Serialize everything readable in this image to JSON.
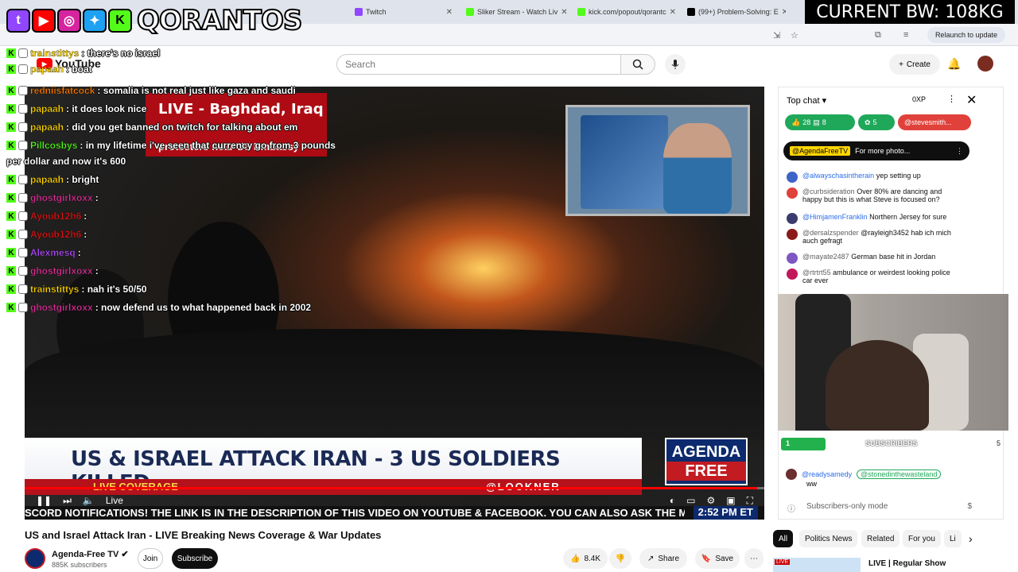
{
  "browser": {
    "tabs": [
      {
        "label": "Twitch",
        "color": "#9146ff"
      },
      {
        "label": "Sliker Stream - Watch Liv",
        "color": "#53fc18"
      },
      {
        "label": "kick.com/popout/qorantc",
        "color": "#53fc18"
      },
      {
        "label": "(99+) Problem-Solving: E",
        "color": "#000000"
      }
    ],
    "relaunch": "Relaunch to update"
  },
  "overlay": {
    "streamer": "QORANTOS",
    "bw_label": "CURRENT BW: 108KG",
    "stream_chat": [
      {
        "user": "trainstittys",
        "msg": ": there's no israel",
        "color": "#ffd600"
      },
      {
        "user": "papaah",
        "msg": ": boat",
        "color": "#ffd600"
      },
      {
        "user": "redniisfatcock",
        "msg": ": somalia is not real just like gaza and saudi",
        "color": "#ff7a00"
      },
      {
        "user": "papaah",
        "msg": ": it does look nice",
        "color": "#ffd600"
      },
      {
        "user": "papaah",
        "msg": ": did you get banned on twitch for talking about em",
        "color": "#ffd600"
      },
      {
        "user": "Pillcosbys",
        "msg": ": in my lifetime i've seen that currency go from 3 pounds",
        "color": "#53fc18"
      },
      {
        "user": "",
        "msg": "per dollar and now it's 600",
        "color": "#ffffff"
      },
      {
        "user": "papaah",
        "msg": ": bright",
        "color": "#ffd600"
      },
      {
        "user": "ghostgirlxoxx",
        "msg": ":",
        "color": "#e0309a"
      },
      {
        "user": "Ayoub12h6",
        "msg": ":",
        "color": "#e01515"
      },
      {
        "user": "Ayoub12h6",
        "msg": ":",
        "color": "#e01515"
      },
      {
        "user": "Alexmesq",
        "msg": ":",
        "color": "#b44cff"
      },
      {
        "user": "ghostgirlxoxx",
        "msg": ":",
        "color": "#e0309a"
      },
      {
        "user": "trainstittys",
        "msg": ": nah it's 50/50",
        "color": "#ffd600"
      },
      {
        "user": "ghostgirlxoxx",
        "msg": ": now defend us to what happened back in 2002",
        "color": "#e0309a"
      }
    ]
  },
  "youtube": {
    "logo": "YouTube",
    "search_placeholder": "Search",
    "create": "Create",
    "video": {
      "live_title": "LIVE - Baghdad, Iraq",
      "live_sub": "protesters near US Embassy",
      "lower_third": "US & ISRAEL ATTACK IRAN - 3 US SOLDIERS KILLED",
      "live_coverage": "LIVE COVERAGE",
      "handle": "@LOOKNER",
      "brand_top": "AGENDA",
      "brand_bottom": "FREE",
      "ticker": "SCORD NOTIFICATIONS! THE LINK IS IN THE DESCRIPTION OF THIS VIDEO ON YOUTUBE & FACEBOOK. YOU CAN ALSO ASK THE MO",
      "ticker_time": "2:52 PM ET",
      "progress": 0.99,
      "live_label": "Live"
    },
    "title": "US and Israel Attack Iran - LIVE Breaking News Coverage & War Updates",
    "channel": {
      "name": "Agenda-Free TV",
      "subs": "885K subscribers",
      "join": "Join",
      "subscribe": "Subscribe"
    },
    "actions": {
      "likes": "8.4K",
      "share": "Share",
      "save": "Save"
    },
    "chat": {
      "header": "Top chat",
      "xp": "0XP",
      "tickers": [
        {
          "label": "28",
          "label2": "8",
          "color": "#1fa85a"
        },
        {
          "label": "5",
          "color": "#1fa85a"
        },
        {
          "label": "@stevesmith...",
          "color": "#e0413a"
        }
      ],
      "pinned_user": "@AgendaFreeTV",
      "pinned_text": "For more photo...",
      "messages": [
        {
          "user": "@alwayschasintherain",
          "text": "yep setting up",
          "av": "#3e64c8",
          "user_blue": true
        },
        {
          "user": "@curbsideration",
          "text": "Over 80% are dancing and happy but this is what Steve is focused on?",
          "av": "#e0413a",
          "user_blue": false
        },
        {
          "user": "@HimjamenFranklin",
          "text": "Northern Jersey for sure",
          "av": "#3c3b6e",
          "user_blue": true
        },
        {
          "user": "@dersalzspender",
          "text": "@rayleigh3452 hab ich mich auch gefragt",
          "av": "#8b1a1a",
          "user_blue": false
        },
        {
          "user": "@mayate2487",
          "text": "German base hit in Jordan",
          "av": "#7e57c2",
          "user_blue": false
        },
        {
          "user": "@rtrtrt55",
          "text": "ambulance or weirdest looking police car ever",
          "av": "#c2185b",
          "user_blue": false
        },
        {
          "user": "@readysamedy",
          "text": "ww",
          "av": "#6b2f2f",
          "user_blue": true
        }
      ],
      "reply_badge": "@stonedinthewasteland",
      "subs_goal_count": "1",
      "subs_goal_label": "SUBSCRIBERS",
      "subs_goal_target": "5",
      "subs_goal_progress": 0.2,
      "mode": "Subscribers-only mode"
    },
    "chips": [
      "All",
      "Politics News",
      "Related",
      "For you",
      "Li"
    ],
    "reco": {
      "live": "LIVE",
      "title": "LIVE | Regular Show"
    }
  }
}
